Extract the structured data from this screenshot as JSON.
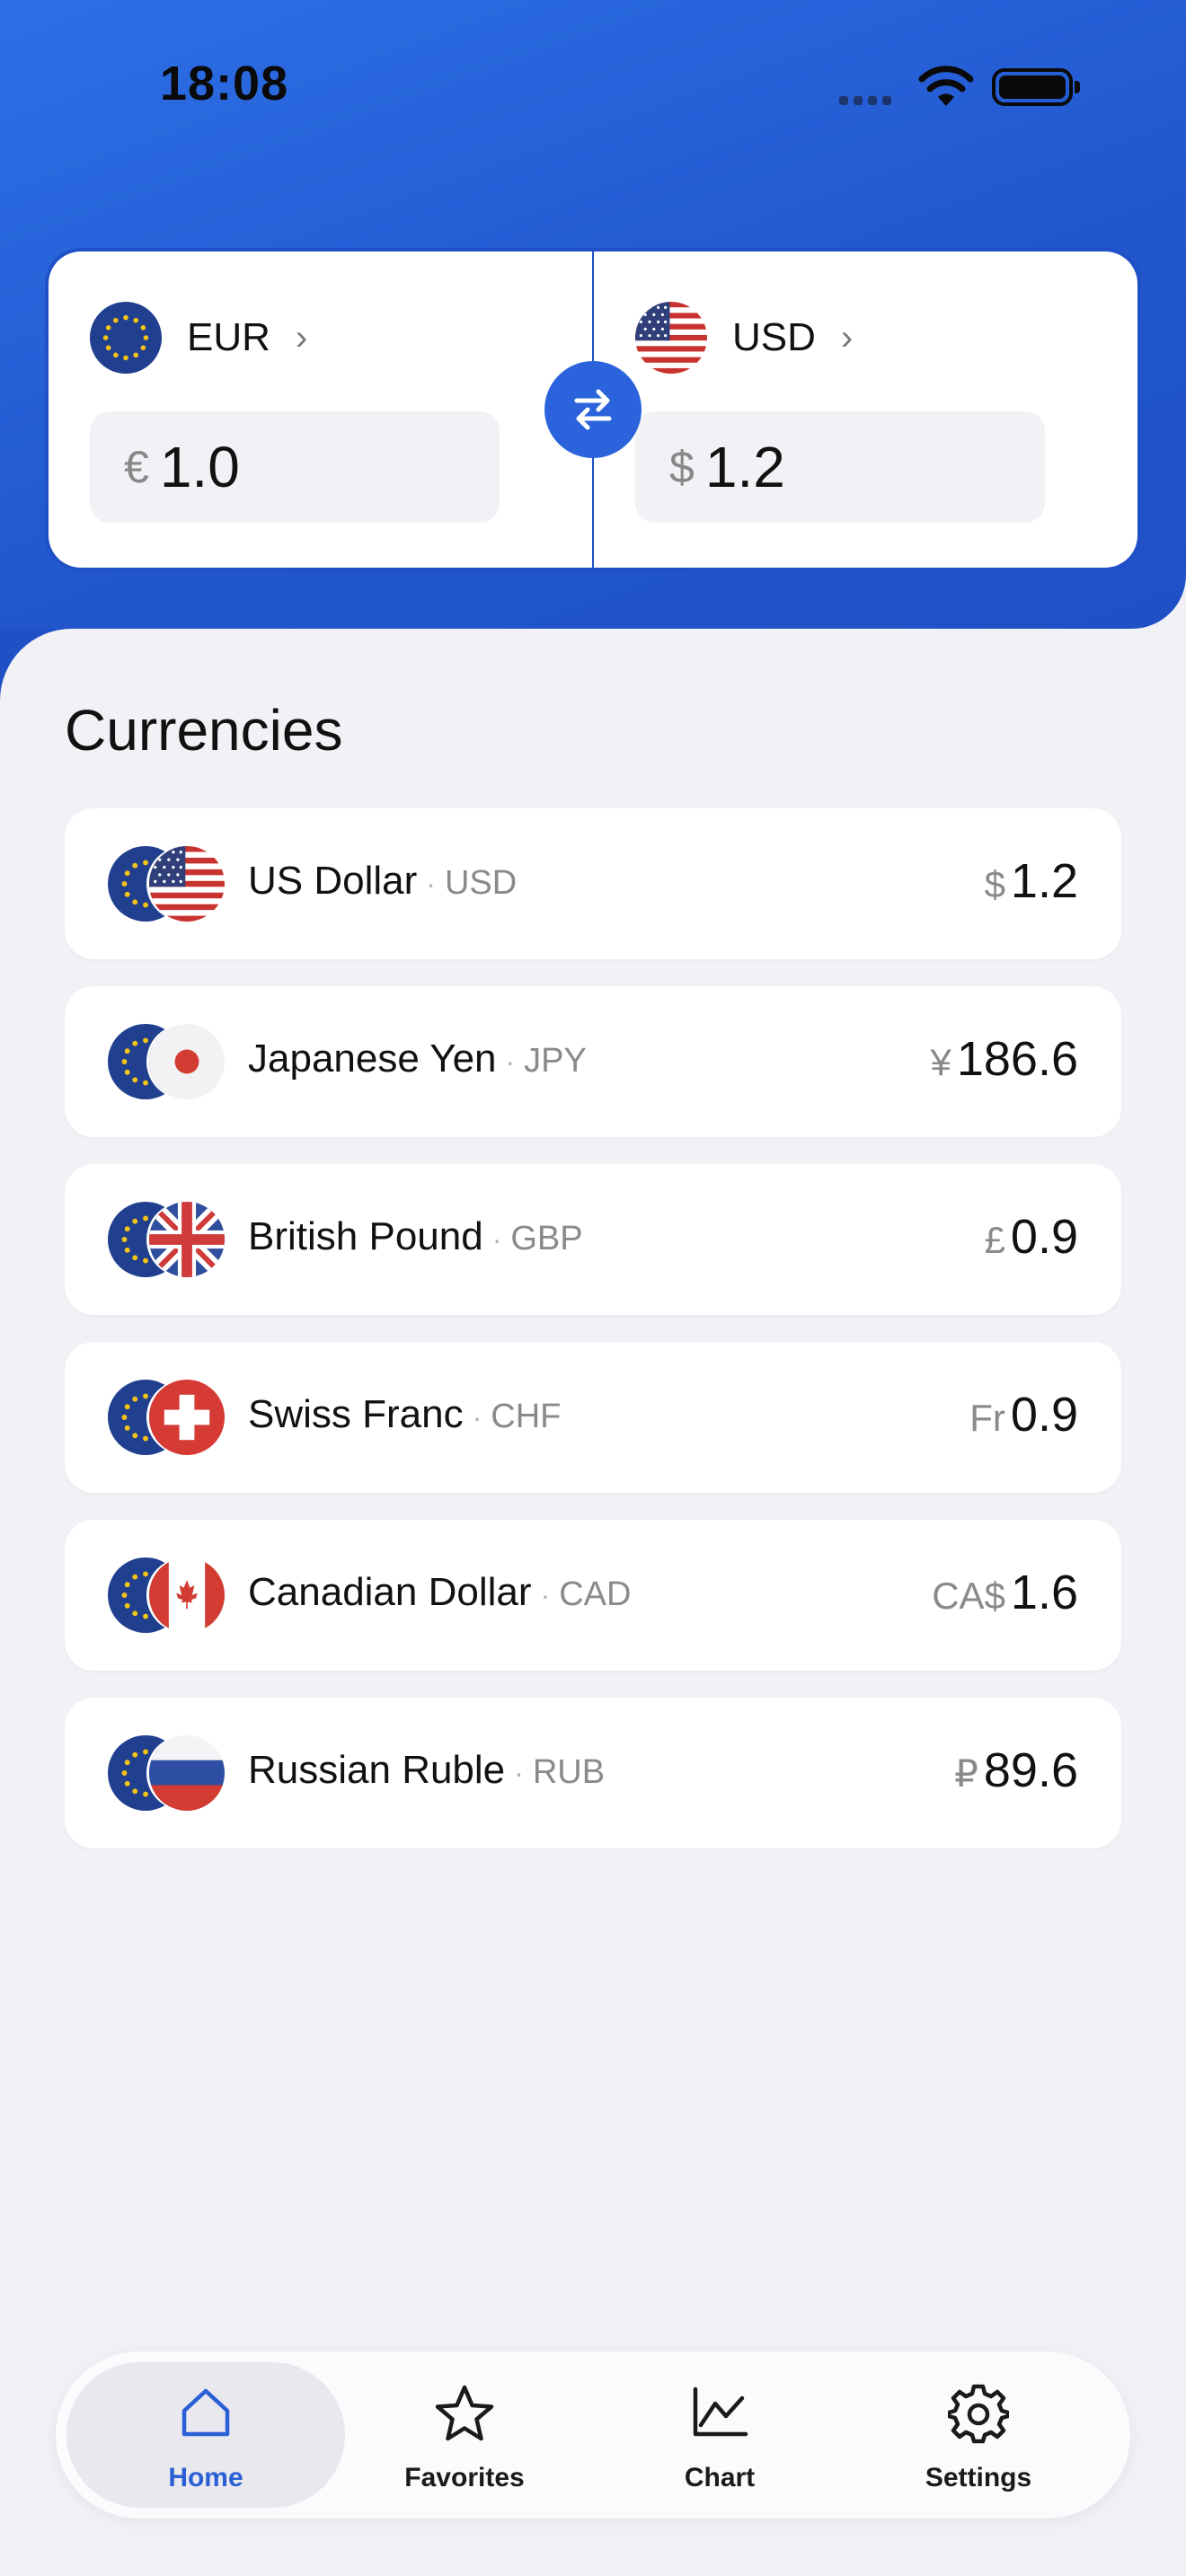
{
  "status_bar": {
    "time": "18:08"
  },
  "colors": {
    "accent": "#2a5fd6",
    "hero_blue": "#2156cd"
  },
  "converter": {
    "from": {
      "code": "EUR",
      "symbol": "€",
      "amount": "1.0",
      "flag": "eu-flag"
    },
    "to": {
      "code": "USD",
      "symbol": "$",
      "amount": "1.2",
      "flag": "us-flag"
    },
    "swap_icon": "swap-arrows-icon"
  },
  "section": {
    "title": "Currencies"
  },
  "currencies": [
    {
      "name": "US Dollar",
      "code": "USD",
      "symbol": "$",
      "value": "1.2",
      "flag": "us-flag"
    },
    {
      "name": "Japanese Yen",
      "code": "JPY",
      "symbol": "¥",
      "value": "186.6",
      "flag": "jp-flag"
    },
    {
      "name": "British Pound",
      "code": "GBP",
      "symbol": "£",
      "value": "0.9",
      "flag": "gb-flag"
    },
    {
      "name": "Swiss Franc",
      "code": "CHF",
      "symbol": "Fr",
      "value": "0.9",
      "flag": "ch-flag"
    },
    {
      "name": "Canadian Dollar",
      "code": "CAD",
      "symbol": "CA$",
      "value": "1.6",
      "flag": "ca-flag"
    },
    {
      "name": "Russian Ruble",
      "code": "RUB",
      "symbol": "₽",
      "value": "89.6",
      "flag": "ru-flag"
    }
  ],
  "tabs": [
    {
      "label": "Home",
      "icon": "home-icon",
      "active": true
    },
    {
      "label": "Favorites",
      "icon": "star-icon",
      "active": false
    },
    {
      "label": "Chart",
      "icon": "chart-icon",
      "active": false
    },
    {
      "label": "Settings",
      "icon": "gear-icon",
      "active": false
    }
  ]
}
